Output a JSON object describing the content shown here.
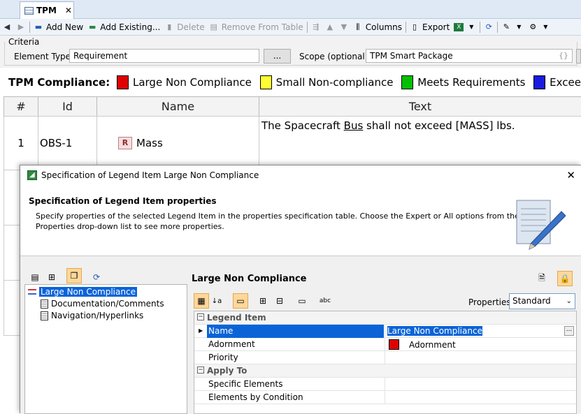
{
  "tab": {
    "title": "TPM",
    "close": "✕"
  },
  "toolbar": {
    "add_new": "Add New",
    "add_existing": "Add Existing...",
    "delete": "Delete",
    "remove_from_table": "Remove From Table",
    "columns": "Columns",
    "export": "Export"
  },
  "criteria": {
    "label": "Criteria",
    "element_type_label": "Element Type:",
    "element_type_value": "Requirement",
    "browse_button": "...",
    "scope_label": "Scope (optional):",
    "scope_value": "TPM Smart Package"
  },
  "legend": {
    "title": "TPM Compliance:",
    "items": [
      {
        "label": "Large Non Compliance",
        "color": "#e00000"
      },
      {
        "label": "Small Non-compliance",
        "color": "#ffff33"
      },
      {
        "label": "Meets Requirements",
        "color": "#00c000"
      },
      {
        "label": "Excee",
        "color": "#1a1ae0"
      }
    ]
  },
  "table": {
    "columns": [
      "#",
      "Id",
      "Name",
      "Text"
    ],
    "rows": [
      {
        "num": "1",
        "id": "OBS-1",
        "name": "Mass",
        "text_before": "The Spacecraft ",
        "text_link": "Bus",
        "text_after": " shall not exceed [MASS] lbs."
      }
    ]
  },
  "dialog": {
    "title": "Specification of Legend Item Large Non Compliance",
    "close": "✕",
    "header_title": "Specification of Legend Item properties",
    "header_desc_1": "Specify properties of the selected Legend Item in the properties specification table. Choose the Expert or All options from the",
    "header_desc_2": "Properties drop-down list to see more properties.",
    "tree": [
      "Large Non Compliance",
      "Documentation/Comments",
      "Navigation/Hyperlinks"
    ],
    "panel_title": "Large Non Compliance",
    "properties_label": "Properties:",
    "properties_value": "Standard",
    "groups": {
      "legend_item": "Legend Item",
      "apply_to": "Apply To"
    },
    "rows": {
      "name_label": "Name",
      "name_value": "Large Non Compliance",
      "adornment_label": "Adornment",
      "adornment_value": "Adornment",
      "adornment_color": "#e00000",
      "priority_label": "Priority",
      "specific_elements": "Specific Elements",
      "elements_by_condition": "Elements by Condition"
    },
    "ellipsis": "..."
  }
}
